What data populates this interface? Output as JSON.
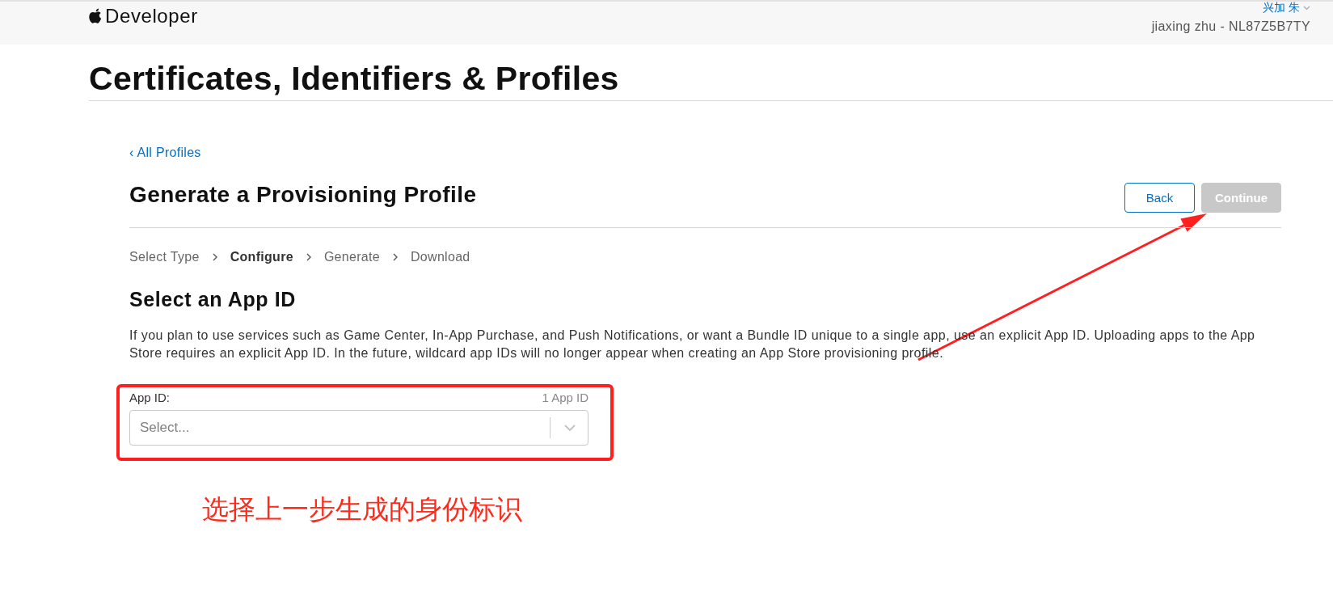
{
  "header": {
    "brand": "Developer",
    "user_name": "兴加 朱",
    "account": "jiaxing zhu - NL87Z5B7TY"
  },
  "page_title": "Certificates, Identifiers & Profiles",
  "back_link": "‹ All Profiles",
  "form_title": "Generate a Provisioning Profile",
  "buttons": [
    {
      "label": "Back",
      "kind": "secondary",
      "disabled": false
    },
    {
      "label": "Continue",
      "kind": "primary",
      "disabled": true
    }
  ],
  "steps": [
    {
      "label": "Select Type",
      "selected": false
    },
    {
      "label": "Configure",
      "selected": true
    },
    {
      "label": "Generate",
      "selected": false
    },
    {
      "label": "Download",
      "selected": false
    }
  ],
  "section": {
    "title": "Select an App ID",
    "description": "If you plan to use services such as Game Center, In-App Purchase, and Push Notifications, or want a Bundle ID unique to a single app, use an explicit App ID. Uploading apps to the App Store requires an explicit App ID. In the future, wildcard app IDs will no longer appear when creating an App Store provisioning profile."
  },
  "field": {
    "label": "App ID:",
    "count": "1 App ID",
    "placeholder": "Select..."
  },
  "annotations": [
    {
      "kind": "box"
    },
    {
      "kind": "arrow"
    },
    {
      "kind": "note",
      "text": "选择上一步生成的身份标识"
    }
  ]
}
